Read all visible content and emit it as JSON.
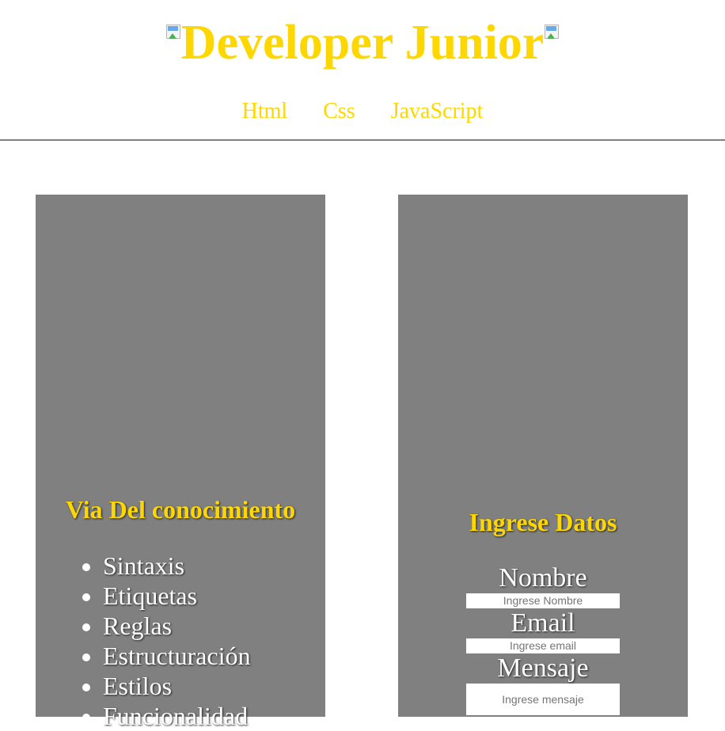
{
  "header": {
    "title": "Developer Junior",
    "nav": [
      {
        "label": "Html"
      },
      {
        "label": "Css"
      },
      {
        "label": "JavaScript"
      }
    ]
  },
  "knowledge_card": {
    "title": "Via Del conocimiento",
    "items": [
      "Sintaxis",
      "Etiquetas",
      "Reglas",
      "Estructuración",
      "Estilos",
      "Funcionalidad"
    ]
  },
  "form_card": {
    "title": "Ingrese Datos",
    "name": {
      "label": "Nombre",
      "placeholder": "Ingrese Nombre"
    },
    "email": {
      "label": "Email",
      "placeholder": "Ingrese email"
    },
    "message": {
      "label": "Mensaje",
      "placeholder": "Ingrese mensaje"
    }
  },
  "colors": {
    "accent": "#ffd700",
    "card_bg": "#808080",
    "divider": "#808080"
  },
  "icons": [
    "broken-image-icon"
  ]
}
